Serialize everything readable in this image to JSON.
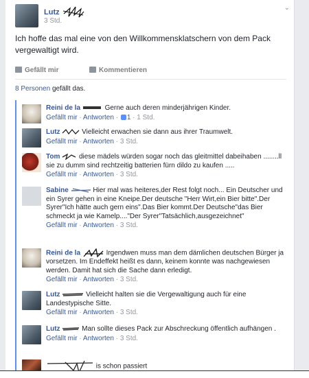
{
  "post": {
    "author": "Lutz",
    "time": "3 Std.",
    "text": "Ich hoffe das mal eine von den Willkommensklatschern von dem Pack vergewaltigt wird.",
    "like_label": "Gefällt mir",
    "comment_label": "Kommentieren",
    "likes_count": "8 Personen",
    "likes_suffix": "gefällt das."
  },
  "comments": [
    {
      "author": "Reini de la",
      "text": "Gerne auch deren minderjährigen Kinder.",
      "like": "Gefällt mir",
      "reply": "Antworten",
      "likes": "1",
      "time": "1 Std.",
      "avatar": "dog"
    },
    {
      "author": "Lutz",
      "text": "Vielleicht erwachen sie dann aus ihrer Traumwelt.",
      "like": "Gefällt mir",
      "reply": "Antworten",
      "time": "3 Std.",
      "avatar": "man"
    },
    {
      "author": "Tom",
      "text": "diese mädels würden sogar noch das gleitmittel dabeihaben ........ll sie zu dumm sind rechtzeitig batterien fürn dildo zu kaufen .....",
      "like": "Gefällt mir",
      "reply": "Antworten",
      "time": "3 Std.",
      "avatar": "red"
    },
    {
      "author": "Sabine",
      "text": "Hier mal was heiteres,der Rest folgt noch... Ein Deutscher und ein Syrer gehen in eine Kneipe.Der deutsche \"Herr Wirt,ein Bier bitte\".Der Syrer\"Ich hätte auch gern eins\".Das Bier kommt.Der Deutsche\"das Bier schmeckt ja wie Kamelp....\"Der Syrer\"Tatsächlich,ausgezeichnet\"",
      "like": "Gefällt mir",
      "reply": "Antworten",
      "time": "3 Std.",
      "avatar": "blank"
    },
    {
      "author": "Reini de la",
      "text": "Irgendwen muss man dem dämlichen deutschen Bürger ja vorsetzen. Im Endeffekt heißt es dann, keinem konnte was nachgewiesen werden. Damit hat sich die Sache dann erledigt.",
      "like": "Gefällt mir",
      "reply": "Antworten",
      "time": "3 Std.",
      "avatar": "dog"
    },
    {
      "author": "Lutz",
      "text": "Vielleicht halten sie die Vergewaltigung auch für eine Landestypische Sitte.",
      "like": "Gefällt mir",
      "reply": "Antworten",
      "time": "3 Std.",
      "avatar": "man"
    },
    {
      "author": "Lutz",
      "text": "Man sollte dieses Pack zur Abschreckung öffentlich aufhängen .",
      "like": "Gefällt mir",
      "reply": "Antworten",
      "time": "3 Std.",
      "avatar": "man"
    },
    {
      "author": "",
      "text": "is schon passiert",
      "avatar": "red2"
    }
  ]
}
